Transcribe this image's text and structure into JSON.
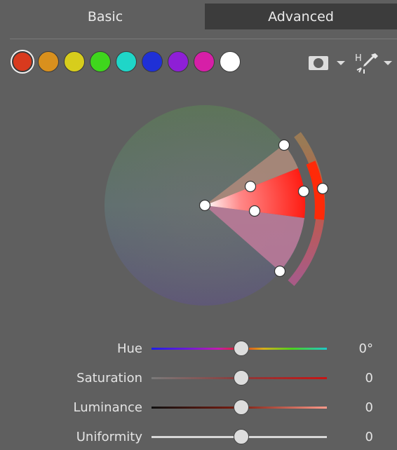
{
  "tabs": [
    {
      "label": "Basic",
      "active": false
    },
    {
      "label": "Advanced",
      "active": true
    }
  ],
  "swatches": [
    {
      "name": "red",
      "color": "#d83a1e",
      "selected": true
    },
    {
      "name": "orange",
      "color": "#d9901d",
      "selected": false
    },
    {
      "name": "yellow",
      "color": "#d7cd1c",
      "selected": false
    },
    {
      "name": "green",
      "color": "#3fd61d",
      "selected": false
    },
    {
      "name": "aqua",
      "color": "#1fd6c8",
      "selected": false
    },
    {
      "name": "blue",
      "color": "#1f30d6",
      "selected": false
    },
    {
      "name": "purple",
      "color": "#8e1fd6",
      "selected": false
    },
    {
      "name": "magenta",
      "color": "#d61fa7",
      "selected": false
    },
    {
      "name": "white",
      "color": "#ffffff",
      "selected": false
    }
  ],
  "toolbar": {
    "mask_icon": "mask-icon",
    "picker_icon": "hue-eyedropper-icon",
    "picker_letter": "H"
  },
  "sliders": [
    {
      "key": "hue",
      "label": "Hue",
      "value": "0°",
      "position": 0.5
    },
    {
      "key": "saturation",
      "label": "Saturation",
      "value": "0",
      "position": 0.5
    },
    {
      "key": "luminance",
      "label": "Luminance",
      "value": "0",
      "position": 0.5
    },
    {
      "key": "uniformity",
      "label": "Uniformity",
      "value": "0",
      "position": 0.5
    }
  ]
}
